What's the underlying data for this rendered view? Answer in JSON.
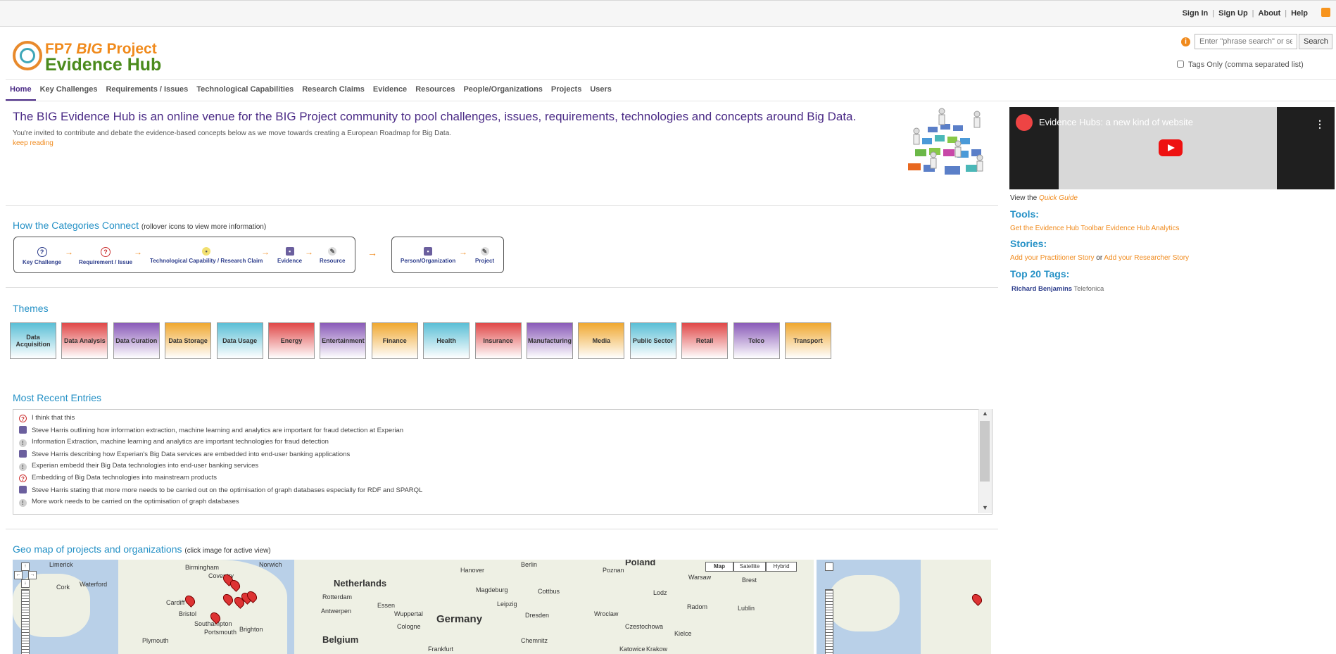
{
  "topbar": {
    "links": [
      "Sign In",
      "Sign Up",
      "About",
      "Help"
    ]
  },
  "logo": {
    "line1_prefix": "FP7 ",
    "line1_big": "BIG",
    "line1_suffix": " Project",
    "line2": "Evidence Hub"
  },
  "search": {
    "placeholder": "Enter \"phrase search\" or sep",
    "button": "Search",
    "tags_only_label": "Tags Only (comma separated list)"
  },
  "nav": [
    "Home",
    "Key Challenges",
    "Requirements / Issues",
    "Technological Capabilities",
    "Research Claims",
    "Evidence",
    "Resources",
    "People/Organizations",
    "Projects",
    "Users"
  ],
  "intro": {
    "title": "The BIG Evidence Hub is an online venue for the BIG Project community to pool challenges, issues, requirements, technologies and concepts around Big Data.",
    "text": "You're invited to contribute and debate the evidence-based concepts below as we move towards creating a European Roadmap for Big Data.",
    "more": "keep reading"
  },
  "categories": {
    "title": "How the Categories Connect",
    "hint": "(rollover icons to view more information)",
    "flow1": [
      "Key Challenge",
      "Requirement / Issue",
      "Technological Capability / Research Claim",
      "Evidence",
      "Resource"
    ],
    "flow2": [
      "Person/Organization",
      "Project"
    ]
  },
  "themes": {
    "title": "Themes",
    "items": [
      {
        "label": "Data Acquisition",
        "color": "#5bbfd6"
      },
      {
        "label": "Data Analysis",
        "color": "#e04848"
      },
      {
        "label": "Data Curation",
        "color": "#8a5bb8"
      },
      {
        "label": "Data Storage",
        "color": "#f0a830"
      },
      {
        "label": "Data Usage",
        "color": "#5bbfd6"
      },
      {
        "label": "Energy",
        "color": "#e04848"
      },
      {
        "label": "Entertainment",
        "color": "#8a5bb8"
      },
      {
        "label": "Finance",
        "color": "#f0a830"
      },
      {
        "label": "Health",
        "color": "#5bbfd6"
      },
      {
        "label": "Insurance",
        "color": "#e04848"
      },
      {
        "label": "Manufacturing",
        "color": "#8a5bb8"
      },
      {
        "label": "Media",
        "color": "#f0a830"
      },
      {
        "label": "Public Sector",
        "color": "#5bbfd6"
      },
      {
        "label": "Retail",
        "color": "#e04848"
      },
      {
        "label": "Telco",
        "color": "#8a5bb8"
      },
      {
        "label": "Transport",
        "color": "#f0a830"
      }
    ]
  },
  "recent": {
    "title": "Most Recent Entries",
    "entries": [
      {
        "icon": "question-icon",
        "type": "q",
        "text": "I think that this"
      },
      {
        "icon": "evidence-icon",
        "type": "e",
        "text": "Steve Harris outlining how information extraction, machine learning and analytics are important for fraud detection at Experian"
      },
      {
        "icon": "claim-icon",
        "type": "t",
        "text": "Information Extraction, machine learning and analytics are important technologies for fraud detection"
      },
      {
        "icon": "evidence-icon",
        "type": "e",
        "text": "Steve Harris describing how Experian's Big Data services are embedded into end-user banking applications"
      },
      {
        "icon": "claim-icon",
        "type": "t",
        "text": "Experian embedd their Big Data technologies into end-user banking services"
      },
      {
        "icon": "question-icon",
        "type": "q",
        "text": "Embedding of Big Data technologies into mainstream products"
      },
      {
        "icon": "evidence-icon",
        "type": "e",
        "text": "Steve Harris stating that more more needs to be carried out on the optimisation of graph databases especially for RDF and SPARQL"
      },
      {
        "icon": "claim-icon",
        "type": "t",
        "text": "More work needs to be carried on the optimisation of graph databases"
      }
    ]
  },
  "geo": {
    "title": "Geo map of projects and organizations",
    "hint": "(click image for active view)",
    "map_buttons": [
      "Map",
      "Satellite",
      "Hybrid"
    ],
    "labels": [
      "Limerick",
      "Birmingham",
      "Norwich",
      "Cork",
      "Waterford",
      "Coventry",
      "Cardiff",
      "Bristol",
      "Southampton",
      "Portsmouth",
      "Brighton",
      "Plymouth",
      "Netherlands",
      "Rotterdam",
      "Antwerpen",
      "Belgium",
      "Germany",
      "Hanover",
      "Berlin",
      "Magdeburg",
      "Leipzig",
      "Dresden",
      "Poland",
      "Poznan",
      "Warsaw",
      "Lodz",
      "Wroclaw",
      "Krakow",
      "Frankfurt",
      "Cologne",
      "Wuppertal",
      "Essen",
      "Brest",
      "Radom",
      "Kielce",
      "Lublin",
      "Czestochowa",
      "Katowice",
      "Chemnitz",
      "Cottbus"
    ]
  },
  "sidebar": {
    "video_title": "Evidence Hubs: a new kind of website",
    "view_prefix": "View the",
    "view_link": "Quick Guide",
    "tools_head": "Tools:",
    "tools_link1": "Get the Evidence Hub Toolbar",
    "tools_link2": "Evidence Hub Analytics",
    "stories_head": "Stories:",
    "story_link1": "Add your Practitioner Story",
    "story_or": "or",
    "story_link2": "Add your Researcher Story",
    "tags_head": "Top 20 Tags:",
    "tag1": "Richard Benjamins",
    "tag2": "Telefonica"
  }
}
